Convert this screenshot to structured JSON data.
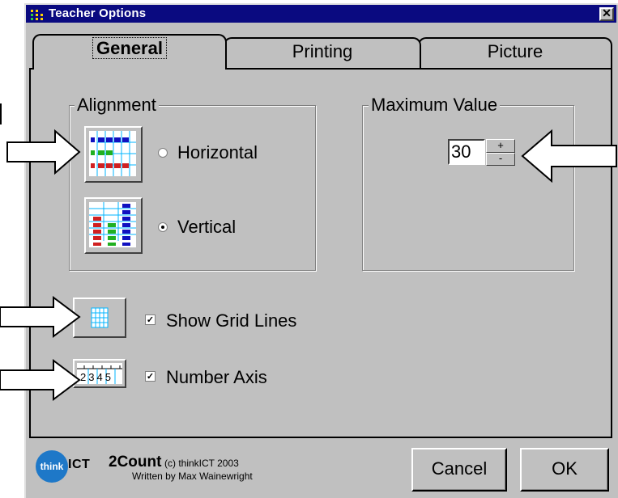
{
  "window": {
    "title": "Teacher Options",
    "close_glyph": "✕"
  },
  "tabs": [
    {
      "label": "General",
      "selected": true
    },
    {
      "label": "Printing",
      "selected": false
    },
    {
      "label": "Picture",
      "selected": false
    }
  ],
  "alignment": {
    "label": "Alignment",
    "horizontal_label": "Horizontal",
    "vertical_label": "Vertical",
    "selected": "Vertical"
  },
  "maximum_value": {
    "label": "Maximum Value",
    "value": "30",
    "up": "+",
    "down": "-"
  },
  "options": {
    "grid_label": "Show Grid Lines",
    "grid_checked": true,
    "axis_label": "Number Axis",
    "axis_checked": true,
    "axis_icon_text": "2345",
    "check_glyph": "✓"
  },
  "footer": {
    "logo_text": "think",
    "logo_suffix": "ICT",
    "app_name": "2Count",
    "copyright": "(c) thinkICT 2003",
    "author": "Written by Max Wainewright"
  },
  "buttons": {
    "cancel": "Cancel",
    "ok": "OK"
  },
  "icons": {
    "app_icon": "app-grid-icon",
    "horizontal_icon": "horizontal-bar-chart-icon",
    "vertical_icon": "vertical-bar-chart-icon",
    "grid_icon": "grid-icon",
    "axis_icon": "number-axis-icon",
    "arrow": "pointer-arrow-icon"
  },
  "colors": {
    "title_bar": "#0a0a80",
    "face": "#c0c0c0",
    "logo": "#1e78c8"
  }
}
